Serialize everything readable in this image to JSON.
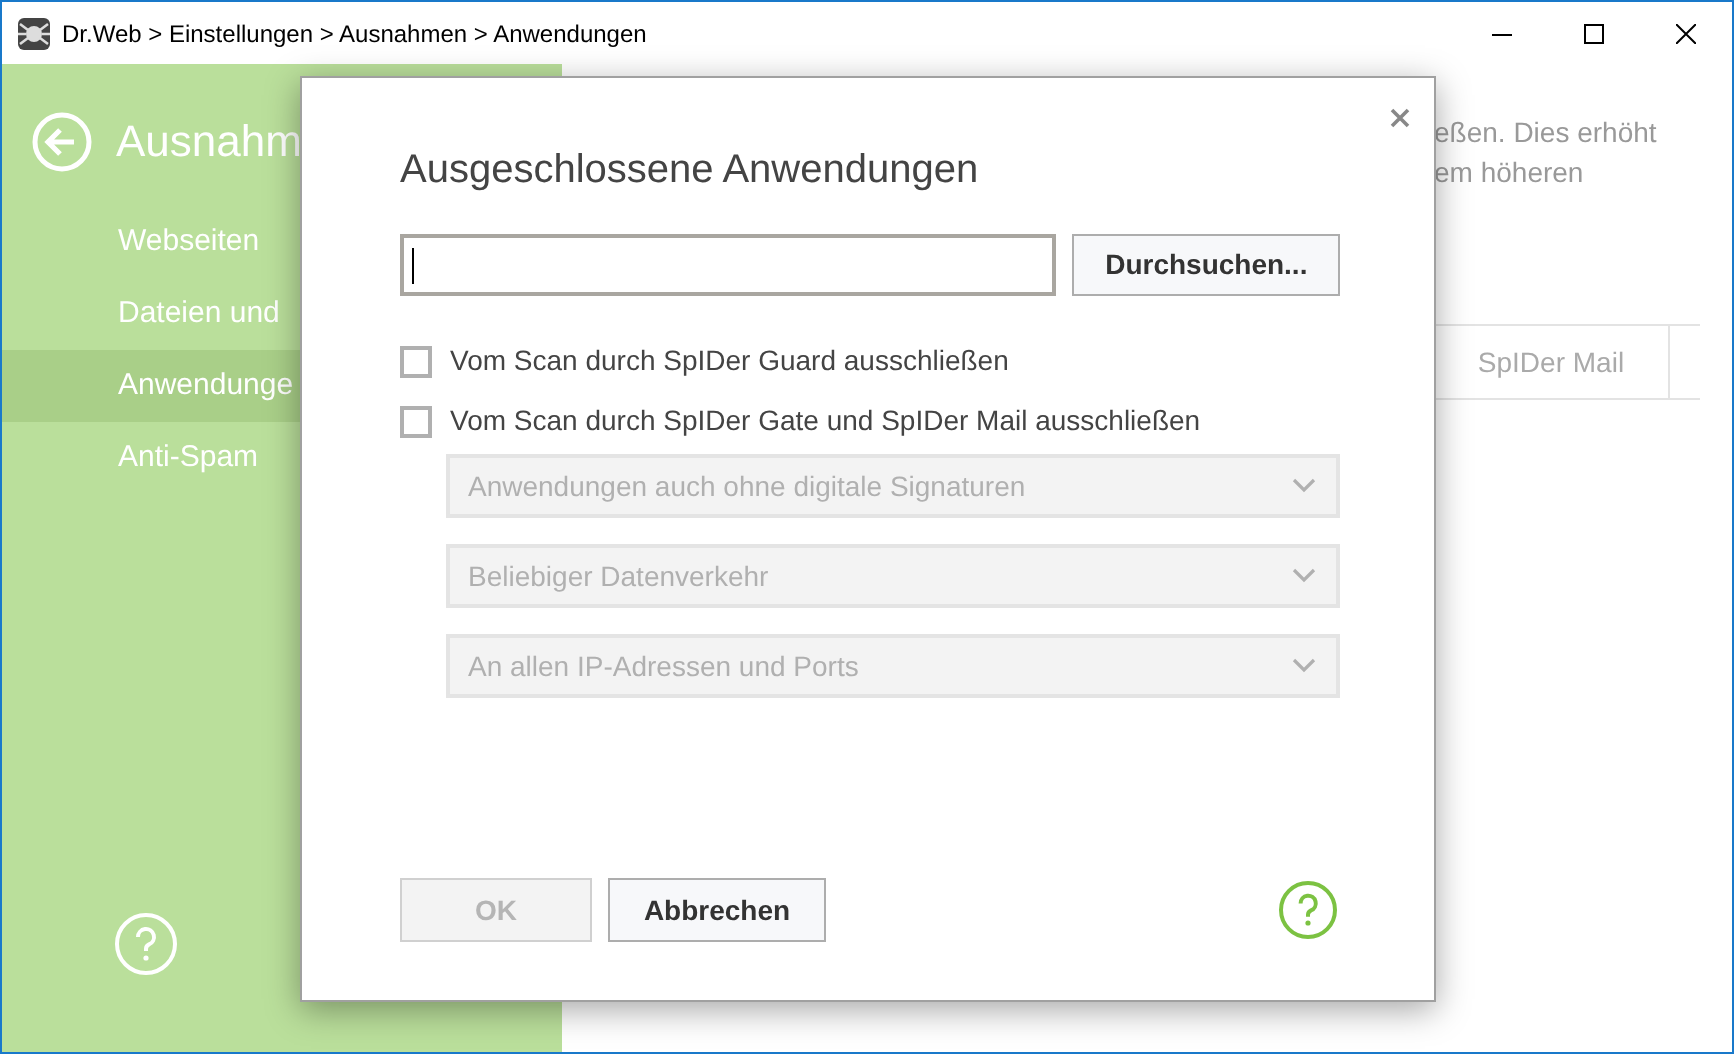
{
  "window": {
    "title": "Dr.Web > Einstellungen > Ausnahmen > Anwendungen"
  },
  "sidebar": {
    "title": "Ausnahm",
    "items": [
      {
        "label": "Webseiten",
        "selected": false
      },
      {
        "label": "Dateien und",
        "selected": false
      },
      {
        "label": "Anwendunge",
        "selected": true
      },
      {
        "label": "Anti-Spam",
        "selected": false
      }
    ]
  },
  "background": {
    "description_lines": [
      "eßen. Dies erhöht",
      "em höheren"
    ],
    "table_columns": [
      "SpIDer Mail"
    ]
  },
  "dialog": {
    "title": "Ausgeschlossene Anwendungen",
    "browse_button": "Durchsuchen...",
    "checkboxes": [
      {
        "label": "Vom Scan durch SpIDer Guard ausschließen",
        "checked": false
      },
      {
        "label": "Vom Scan durch SpIDer Gate und SpIDer Mail ausschließen",
        "checked": false
      }
    ],
    "dropdowns": [
      {
        "value": "Anwendungen auch ohne digitale Signaturen",
        "disabled": true
      },
      {
        "value": "Beliebiger Datenverkehr",
        "disabled": true
      },
      {
        "value": "An allen IP-Adressen und Ports",
        "disabled": true
      }
    ],
    "buttons": [
      {
        "label": "OK",
        "disabled": true
      },
      {
        "label": "Abbrechen",
        "disabled": false
      }
    ]
  }
}
